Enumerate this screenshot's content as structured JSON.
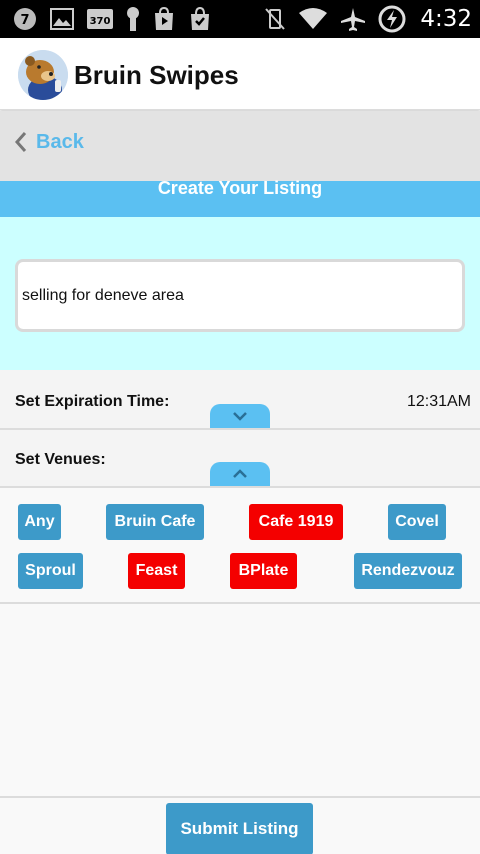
{
  "status_bar": {
    "notifications": [
      "notification-7-icon",
      "image-icon",
      "news-370-icon",
      "keyhole-icon",
      "play-store-icon",
      "shopping-bag-icon"
    ],
    "system": [
      "vibrate-off-icon",
      "wifi-icon",
      "airplane-mode-icon",
      "battery-charging-icon"
    ],
    "notification_badge_7": "7",
    "notification_badge_370": "370",
    "time": "4:32"
  },
  "app_bar": {
    "title": "Bruin Swipes",
    "logo_icon": "bruin-bear-logo"
  },
  "back": {
    "label": "Back"
  },
  "listing": {
    "header": "Create Your Listing",
    "description_value": "selling for deneve area"
  },
  "expiration": {
    "label": "Set Expiration Time:",
    "value": "12:31AM"
  },
  "venues": {
    "label": "Set Venues:",
    "items": [
      {
        "label": "Any",
        "selected": false
      },
      {
        "label": "Bruin Cafe",
        "selected": false
      },
      {
        "label": "Cafe 1919",
        "selected": true
      },
      {
        "label": "Covel",
        "selected": false
      },
      {
        "label": "Sproul",
        "selected": false
      },
      {
        "label": "Feast",
        "selected": true
      },
      {
        "label": "BPlate",
        "selected": true
      },
      {
        "label": "Rendezvouz",
        "selected": false
      }
    ]
  },
  "submit": {
    "label": "Submit Listing"
  },
  "colors": {
    "accent": "#5bc0f2",
    "button_blue": "#3d9ac9",
    "selected_red": "#f40000",
    "description_bg": "#ccffff",
    "back_link": "#5ab9ea"
  }
}
